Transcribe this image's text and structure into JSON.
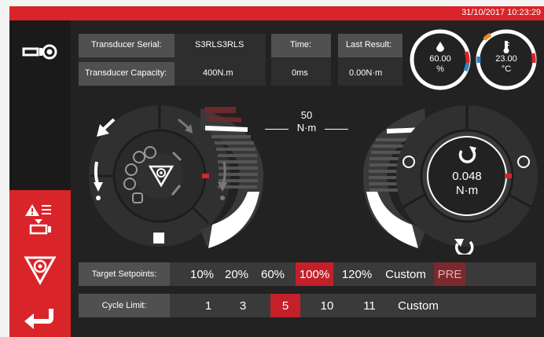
{
  "status_bar": {
    "datetime": "31/10/2017 10:23:29"
  },
  "transducer": {
    "serial_label": "Transducer Serial:",
    "serial_value": "S3RLS3RLS",
    "capacity_label": "Transducer Capacity:",
    "capacity_value": "400N.m"
  },
  "time": {
    "label": "Time:",
    "value": "0ms"
  },
  "last_result": {
    "label": "Last Result:",
    "value": "0.00N·m"
  },
  "humidity_gauge": {
    "value": "60.00",
    "unit": "%",
    "icon": "droplet-icon"
  },
  "temperature_gauge": {
    "value": "23.00",
    "unit": "°C",
    "icon": "thermometer-icon"
  },
  "scale": {
    "max_value": "50",
    "unit": "N·m"
  },
  "torque": {
    "value": "0.048",
    "unit": "N·m"
  },
  "target_setpoints": {
    "label": "Target Setpoints:",
    "options": [
      "10%",
      "20%",
      "60%",
      "100%",
      "120%",
      "Custom",
      "PRE"
    ],
    "selected": "100%"
  },
  "cycle_limit": {
    "label": "Cycle Limit:",
    "options": [
      "1",
      "3",
      "5",
      "10",
      "11",
      "Custom"
    ],
    "selected": "5"
  },
  "colors": {
    "accent": "#d92429",
    "background": "#1d1d1d",
    "panel": "#3a3a3a"
  }
}
